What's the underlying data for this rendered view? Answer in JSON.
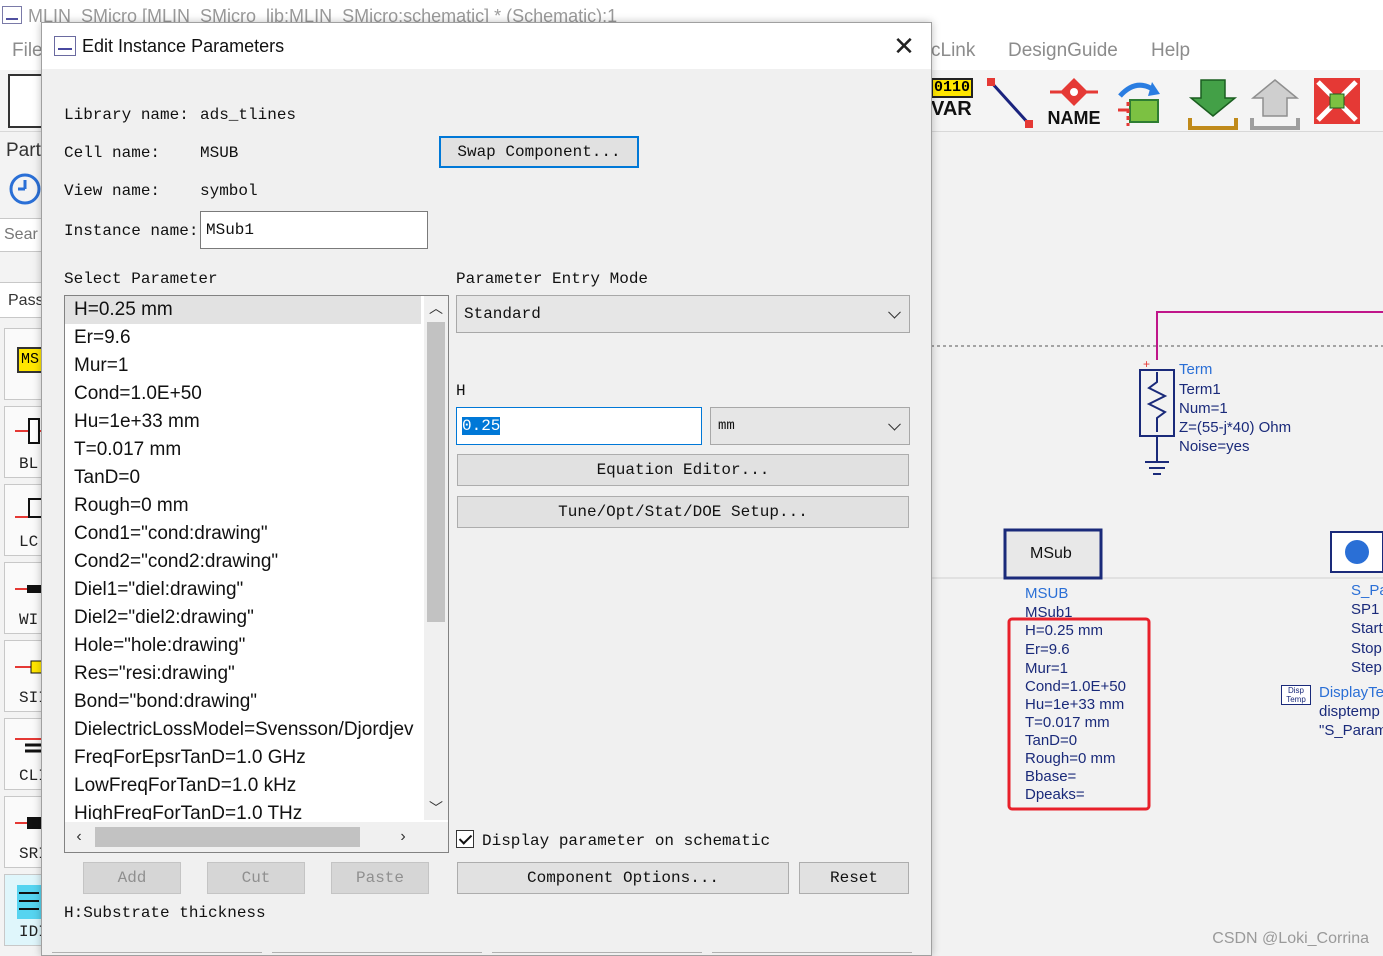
{
  "app": {
    "title": "MLIN_SMicro [MLIN_SMicro_lib:MLIN_SMicro:schematic] * (Schematic):1",
    "menu": [
      "File",
      "cLink",
      "DesignGuide",
      "Help"
    ]
  },
  "toolbar": {
    "var_label": "VAR",
    "var_top": "0110",
    "name_label": "NAME"
  },
  "left_panel": {
    "parts_label": "Part",
    "search_placeholder": "Sear",
    "pass_label": "Pass",
    "palette": [
      "MS",
      "BL",
      "LC",
      "WI",
      "SII",
      "CLI",
      "SRI",
      "IDI"
    ]
  },
  "dialog": {
    "title": "Edit Instance Parameters",
    "library_label": "Library name:",
    "library_value": "ads_tlines",
    "cell_label": "Cell name:",
    "cell_value": "MSUB",
    "view_label": "View name:",
    "view_value": "symbol",
    "instance_label": "Instance name:",
    "instance_value": "MSub1",
    "swap_button": "Swap Component...",
    "select_param_label": "Select Parameter",
    "entry_mode_label": "Parameter Entry Mode",
    "entry_mode_value": "Standard",
    "param_name": "H",
    "param_value": "0.25",
    "unit_value": "mm",
    "equation_button": "Equation Editor...",
    "tune_button": "Tune/Opt/Stat/DOE Setup...",
    "display_checkbox_label": "Display parameter on schematic",
    "display_checked": true,
    "add_button": "Add",
    "cut_button": "Cut",
    "paste_button": "Paste",
    "options_button": "Component Options...",
    "reset_button": "Reset",
    "status": "H:Substrate thickness",
    "parameters": [
      "H=0.25 mm",
      "Er=9.6",
      "Mur=1",
      "Cond=1.0E+50",
      "Hu=1e+33 mm",
      "T=0.017 mm",
      "TanD=0",
      "Rough=0 mm",
      "Cond1=\"cond:drawing\"",
      "Cond2=\"cond2:drawing\"",
      "Diel1=\"diel:drawing\"",
      "Diel2=\"diel2:drawing\"",
      "Hole=\"hole:drawing\"",
      "Res=\"resi:drawing\"",
      "Bond=\"bond:drawing\"",
      "DielectricLossModel=Svensson/Djordjev",
      "FreqForEpsrTanD=1.0 GHz",
      "LowFreqForTanD=1.0 kHz",
      "HighFreqForTanD=1.0 THz"
    ]
  },
  "schematic": {
    "term_type": "Term",
    "term_name": "Term1",
    "term_num": "Num=1",
    "term_z": "Z=(55-j*40) Ohm",
    "term_noise": "Noise=yes",
    "msub_box": "MSub",
    "msub_type": "MSUB",
    "msub_name": "MSub1",
    "msub_params": [
      "H=0.25 mm",
      "Er=9.6",
      "Mur=1",
      "Cond=1.0E+50",
      "Hu=1e+33 mm",
      "T=0.017 mm",
      "TanD=0",
      "Rough=0 mm",
      "Bbase=",
      "Dpeaks="
    ],
    "sp_type": "S_Pa",
    "sp_name": "SP1",
    "sp_params": [
      "Start",
      "Stop",
      "Step"
    ],
    "disp_icon": "Disp Temp",
    "disp_type": "DisplayTe",
    "disp_name": "disptemp",
    "disp_val": "\"S_Param"
  },
  "watermark": "CSDN @Loki_Corrina",
  "colors": {
    "accent": "#0078d7",
    "highlight_box": "#e8202a",
    "wire": "#c0168a",
    "label_blue": "#2a6fd6"
  }
}
